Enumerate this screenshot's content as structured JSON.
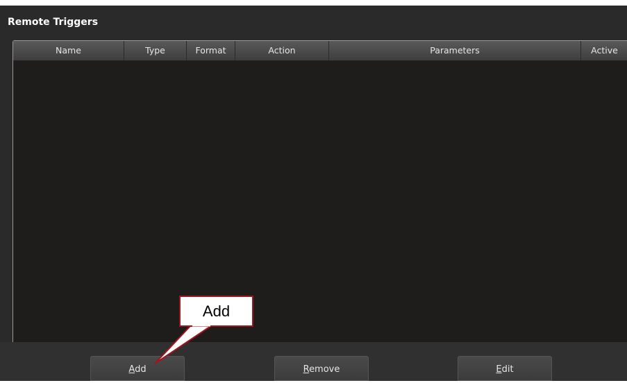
{
  "panel": {
    "title": "Remote Triggers"
  },
  "table": {
    "columns": [
      "Name",
      "Type",
      "Format",
      "Action",
      "Parameters",
      "Active"
    ],
    "rows": []
  },
  "buttons": {
    "add": {
      "mnemonic": "A",
      "rest": "dd"
    },
    "remove": {
      "mnemonic": "R",
      "rest": "emove"
    },
    "edit": {
      "mnemonic": "E",
      "rest": "dit"
    }
  },
  "callout": {
    "text": "Add",
    "border_color": "#a3141c"
  }
}
